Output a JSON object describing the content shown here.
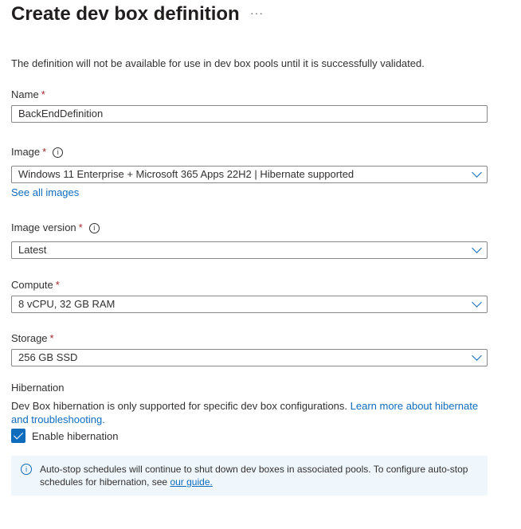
{
  "header": {
    "title": "Create dev box definition",
    "more": "···"
  },
  "description": "The definition will not be available for use in dev box pools until it is successfully validated.",
  "name": {
    "label": "Name",
    "required": "*",
    "value": "BackEndDefinition"
  },
  "image": {
    "label": "Image",
    "required": "*",
    "info": "i",
    "value": "Windows 11 Enterprise + Microsoft 365 Apps 22H2 | Hibernate supported",
    "see_all": "See all images"
  },
  "image_version": {
    "label": "Image version",
    "required": "*",
    "info": "i",
    "value": "Latest"
  },
  "compute": {
    "label": "Compute",
    "required": "*",
    "value": "8 vCPU, 32 GB RAM"
  },
  "storage": {
    "label": "Storage",
    "required": "*",
    "value": "256 GB SSD"
  },
  "hibernation": {
    "label": "Hibernation",
    "text": "Dev Box hibernation is only supported for specific dev box configurations.",
    "link": "Learn more about hibernate and troubleshooting.",
    "checkbox_label": "Enable hibernation",
    "checked": true
  },
  "notice": {
    "icon": "i",
    "text": "Auto-stop schedules will continue to shut down dev boxes in associated pools. To configure auto-stop schedules for hibernation, see",
    "link": "our guide."
  },
  "colors": {
    "accent": "#0f6cbd",
    "required": "#a4262c",
    "notice_bg": "#eff6fc"
  }
}
